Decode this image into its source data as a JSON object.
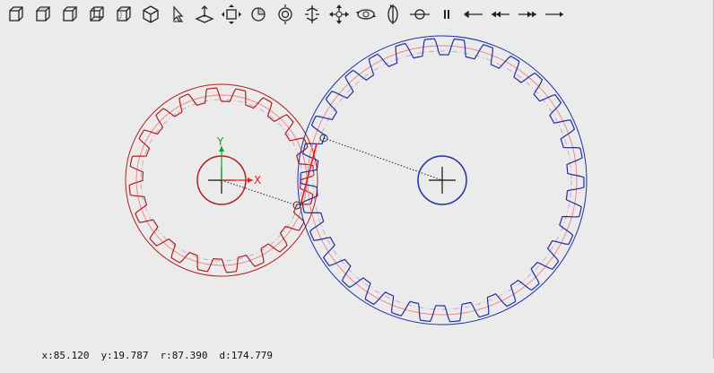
{
  "toolbar": {
    "tools": [
      {
        "id": "view-front",
        "icon": "cube-front-icon"
      },
      {
        "id": "view-top",
        "icon": "cube-top-icon"
      },
      {
        "id": "view-right",
        "icon": "cube-right-icon"
      },
      {
        "id": "view-back",
        "icon": "cube-back-icon"
      },
      {
        "id": "view-left",
        "icon": "cube-left-icon"
      },
      {
        "id": "view-iso",
        "icon": "cube-iso-icon"
      },
      {
        "id": "pick",
        "icon": "pick-icon"
      },
      {
        "id": "origin",
        "icon": "origin-icon"
      },
      {
        "id": "pan",
        "icon": "pan-icon"
      },
      {
        "id": "rotate",
        "icon": "rotate-icon"
      },
      {
        "id": "zoom",
        "icon": "zoom-icon"
      },
      {
        "id": "fit",
        "icon": "fit-icon"
      },
      {
        "id": "move",
        "icon": "move-icon"
      },
      {
        "id": "spin-h",
        "icon": "spin-horizontal-icon"
      },
      {
        "id": "spin-v",
        "icon": "spin-vertical-icon"
      },
      {
        "id": "orbit",
        "icon": "orbit-icon"
      },
      {
        "id": "pause",
        "icon": "pause-icon"
      },
      {
        "id": "step-back",
        "icon": "step-back-icon"
      },
      {
        "id": "fast-back",
        "icon": "fast-back-icon"
      },
      {
        "id": "fast-forward",
        "icon": "fast-forward-icon"
      },
      {
        "id": "step-forward",
        "icon": "step-forward-icon"
      }
    ]
  },
  "axes": {
    "x_label": "X",
    "y_label": "Y",
    "x_color": "#e02020",
    "y_color": "#10a020"
  },
  "gears": {
    "small": {
      "color": "#b02020",
      "teeth": 20
    },
    "large": {
      "color": "#2030a0",
      "teeth": 30
    }
  },
  "status": {
    "x": "x:85.120",
    "y": "y:19.787",
    "r": "r:87.390",
    "d": "d:174.779"
  }
}
